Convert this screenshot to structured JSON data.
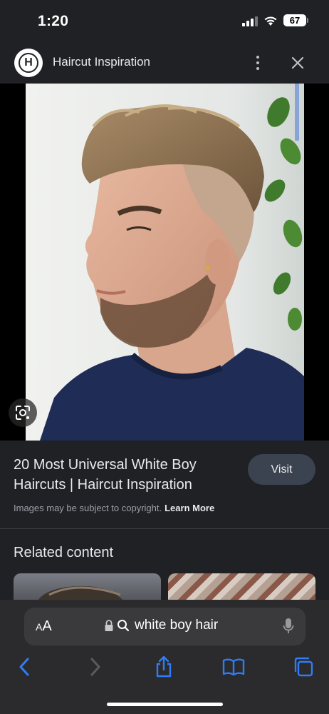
{
  "status_bar": {
    "time": "1:20",
    "battery": "67"
  },
  "header": {
    "site_name": "Haircut Inspiration",
    "logo_letter": "H"
  },
  "result": {
    "title": "20 Most Universal White Boy Haircuts | Haircut Inspiration",
    "visit_label": "Visit",
    "copyright_text": "Images may be subject to copyright.",
    "learn_more_label": "Learn More"
  },
  "related": {
    "heading": "Related content"
  },
  "browser": {
    "text_size_label_small": "A",
    "text_size_label_large": "A",
    "url_text": "white boy hair"
  },
  "colors": {
    "background": "#202124",
    "visit_button": "#3c4350",
    "toolbar_icons": "#2f7cf6",
    "bottom_bar": "#2b2b2d"
  },
  "icons": [
    "signal-icon",
    "wifi-icon",
    "battery-icon",
    "more-icon",
    "close-icon",
    "lens-icon",
    "lock-icon",
    "search-icon",
    "mic-icon",
    "back-icon",
    "forward-icon",
    "share-icon",
    "bookmarks-icon",
    "tabs-icon"
  ]
}
